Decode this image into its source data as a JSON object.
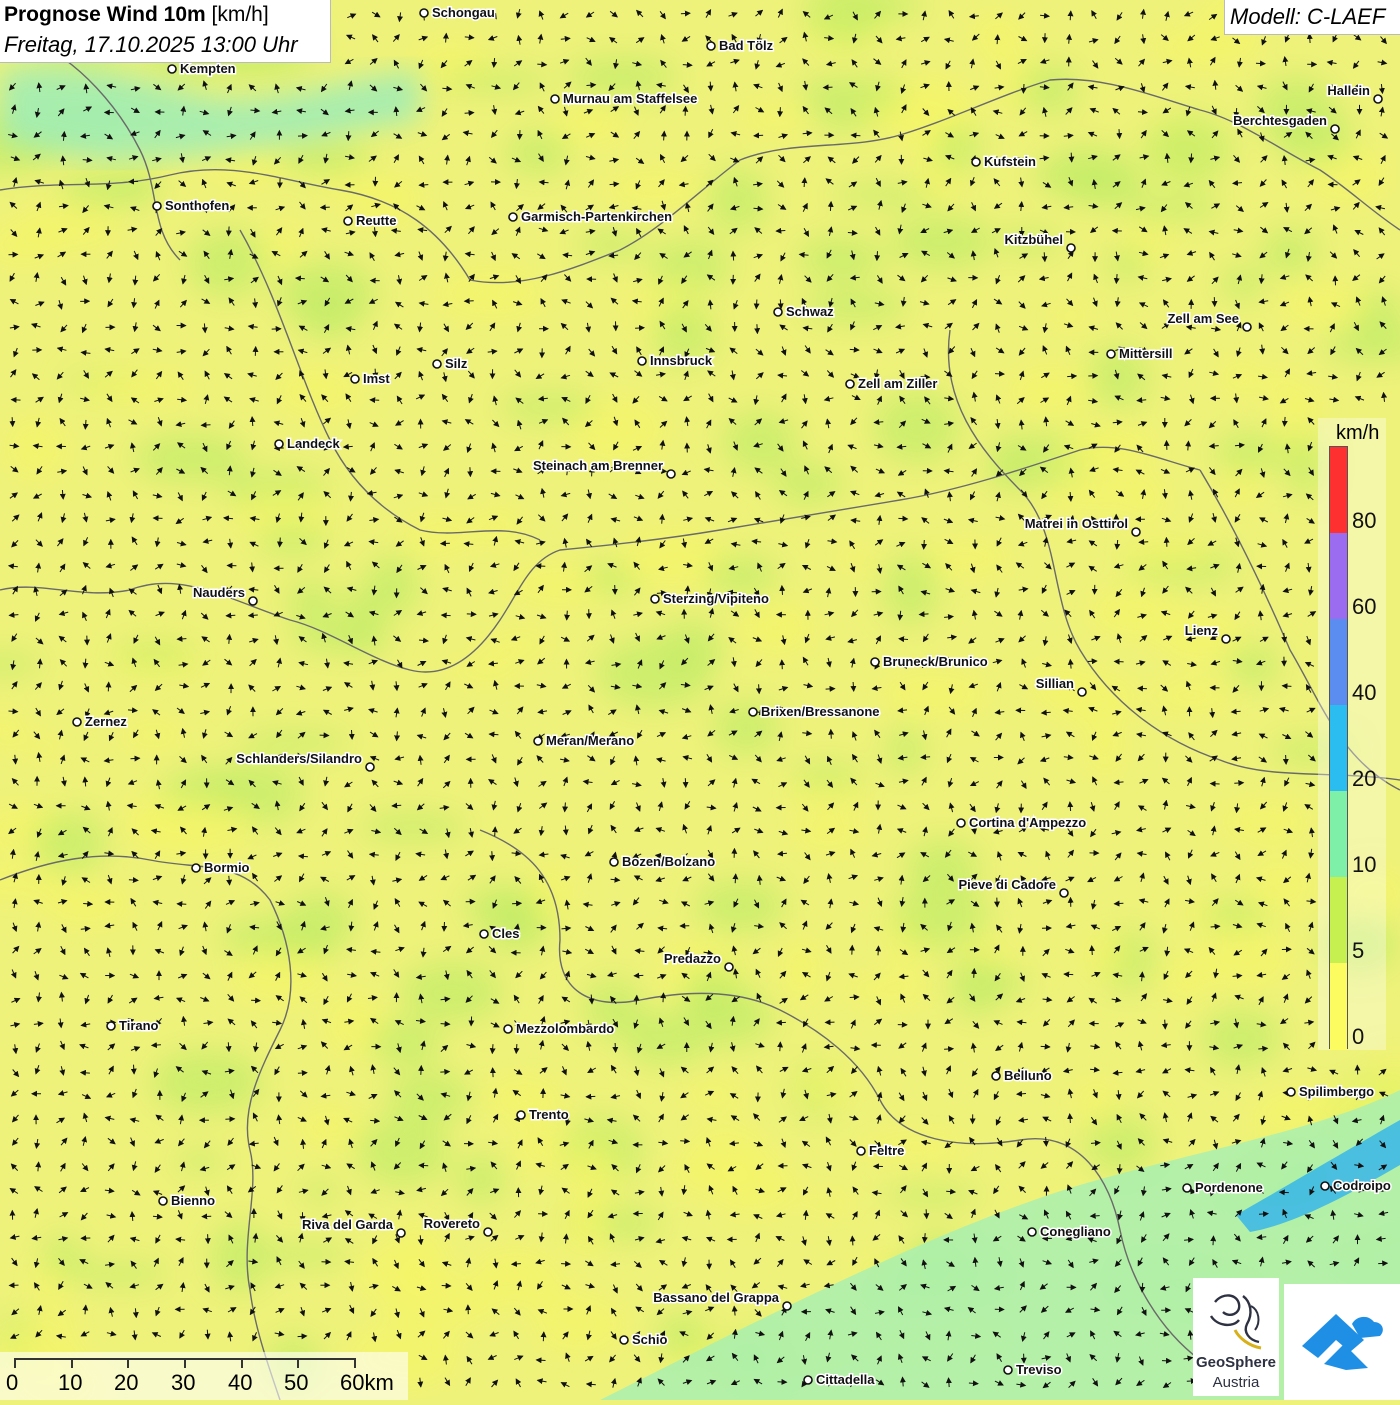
{
  "header": {
    "title_bold": "Prognose Wind 10m",
    "title_unit": " [km/h]",
    "subtitle": "Freitag, 17.10.2025 13:00 Uhr",
    "model": "Modell: C-LAEF"
  },
  "legend": {
    "unit": "km/h",
    "labels": [
      "80",
      "60",
      "40",
      "20",
      "10",
      "5",
      "0"
    ],
    "colors": [
      "#ff3030",
      "#9b6cf0",
      "#5b8cf0",
      "#2bbdf0",
      "#7ef0a8",
      "#c6f050",
      "#fcfc60"
    ]
  },
  "scalebar": {
    "labels": [
      "0",
      "10",
      "20",
      "30",
      "40",
      "50",
      "60km"
    ]
  },
  "cities": [
    {
      "name": "Schongau"
    },
    {
      "name": "Bad Tölz"
    },
    {
      "name": "Kempten"
    },
    {
      "name": "Murnau am Staffelsee"
    },
    {
      "name": "Hallein"
    },
    {
      "name": "Berchtesgaden"
    },
    {
      "name": "Kufstein"
    },
    {
      "name": "Sonthofen"
    },
    {
      "name": "Reutte"
    },
    {
      "name": "Garmisch-Partenkirchen"
    },
    {
      "name": "Kitzbühel"
    },
    {
      "name": "Schwaz"
    },
    {
      "name": "Zell am See"
    },
    {
      "name": "Mittersill"
    },
    {
      "name": "Innsbruck"
    },
    {
      "name": "Silz"
    },
    {
      "name": "Imst"
    },
    {
      "name": "Zell am Ziller"
    },
    {
      "name": "Landeck"
    },
    {
      "name": "Steinach am Brenner"
    },
    {
      "name": "Matrei in Osttirol"
    },
    {
      "name": "Nauders"
    },
    {
      "name": "Sterzing/Vipiteno"
    },
    {
      "name": "Lienz"
    },
    {
      "name": "Bruneck/Brunico"
    },
    {
      "name": "Sillian"
    },
    {
      "name": "Zernez"
    },
    {
      "name": "Brixen/Bressanone"
    },
    {
      "name": "Meran/Merano"
    },
    {
      "name": "Schlanders/Silandro"
    },
    {
      "name": "Cortina d'Ampezzo"
    },
    {
      "name": "Bozen/Bolzano"
    },
    {
      "name": "Bormio"
    },
    {
      "name": "Pieve di Cadore"
    },
    {
      "name": "Cles"
    },
    {
      "name": "Predazzo"
    },
    {
      "name": "Tirano"
    },
    {
      "name": "Mezzolombardo"
    },
    {
      "name": "Belluno"
    },
    {
      "name": "Spilimbergo"
    },
    {
      "name": "Trento"
    },
    {
      "name": "Feltre"
    },
    {
      "name": "Pordenone"
    },
    {
      "name": "Codroipo"
    },
    {
      "name": "Bienno"
    },
    {
      "name": "Riva del Garda"
    },
    {
      "name": "Rovereto"
    },
    {
      "name": "Conegliano"
    },
    {
      "name": "Bassano del Grappa"
    },
    {
      "name": "Schio"
    },
    {
      "name": "Treviso"
    },
    {
      "name": "Cittadella"
    }
  ],
  "logos": {
    "geosphere_line1": "GeoSphere",
    "geosphere_line2": "Austria"
  }
}
